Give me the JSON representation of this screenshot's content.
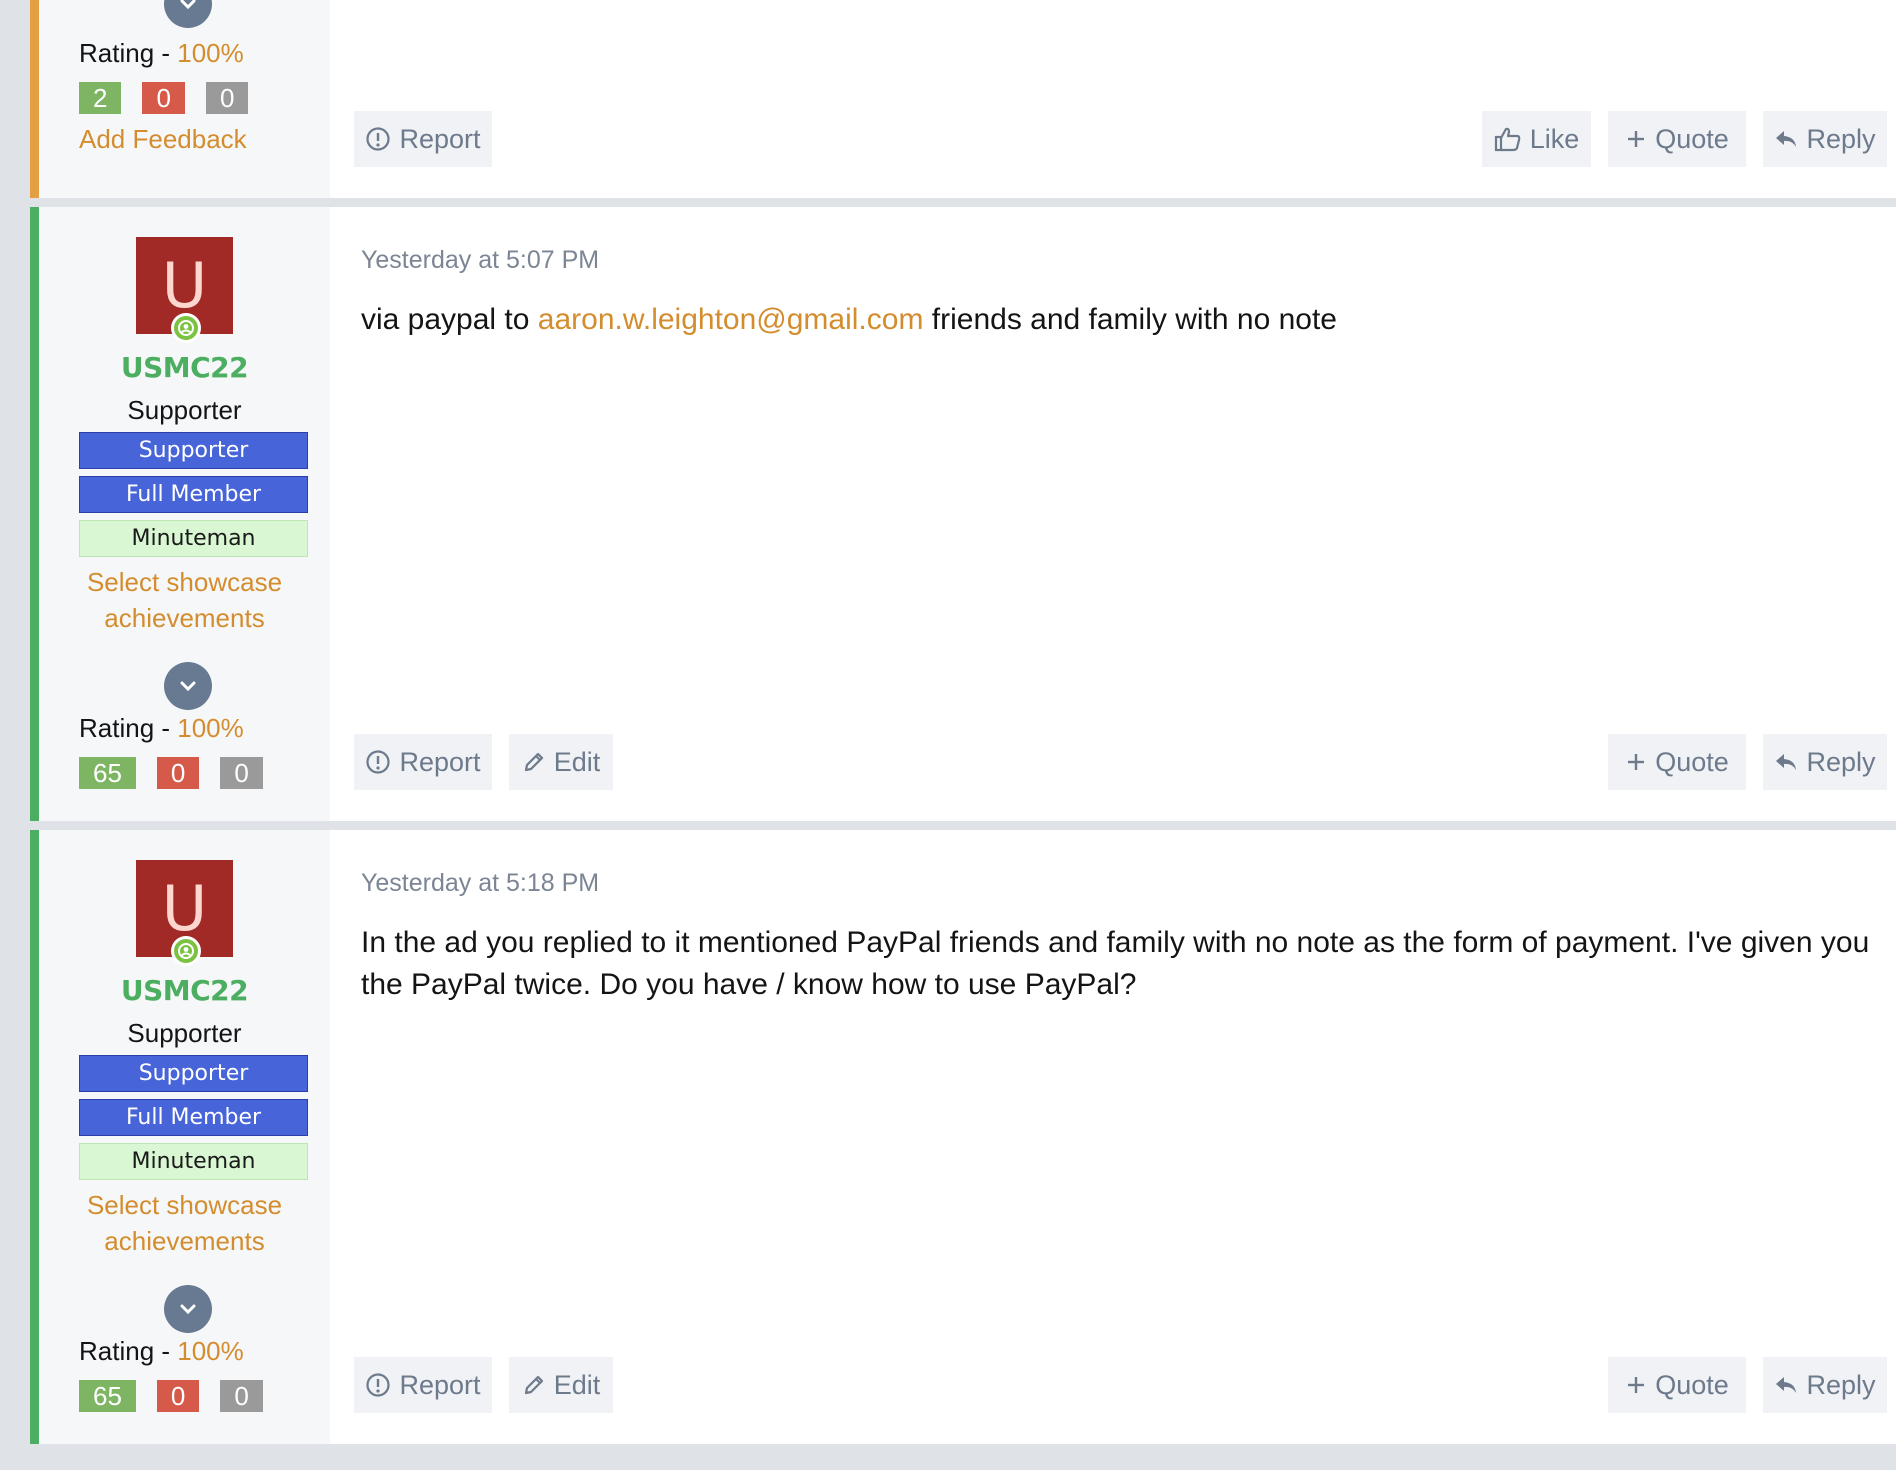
{
  "posts": [
    {
      "rating_label": "Rating - ",
      "rating_pct": "100%",
      "counts": [
        "2",
        "0",
        "0"
      ],
      "add_feedback": "Add Feedback",
      "actions": {
        "report": "Report",
        "like": "Like",
        "quote": "Quote",
        "reply": "Reply"
      }
    },
    {
      "avatar_letter": "U",
      "username": "USMC22",
      "user_title": "Supporter",
      "banners": [
        "Supporter",
        "Full Member",
        "Minuteman"
      ],
      "showcase": [
        "Select showcase",
        "achievements"
      ],
      "rating_label": "Rating - ",
      "rating_pct": "100%",
      "counts": [
        "65",
        "0",
        "0"
      ],
      "timestamp": "Yesterday at 5:07 PM",
      "body_pre": "via paypal to ",
      "body_link": "aaron.w.leighton@gmail.com",
      "body_post": " friends and family with no note",
      "actions": {
        "report": "Report",
        "edit": "Edit",
        "quote": "Quote",
        "reply": "Reply"
      }
    },
    {
      "avatar_letter": "U",
      "username": "USMC22",
      "user_title": "Supporter",
      "banners": [
        "Supporter",
        "Full Member",
        "Minuteman"
      ],
      "showcase": [
        "Select showcase",
        "achievements"
      ],
      "rating_label": "Rating - ",
      "rating_pct": "100%",
      "counts": [
        "65",
        "0",
        "0"
      ],
      "timestamp": "Yesterday at 5:18 PM",
      "body": "In the ad you replied to it mentioned PayPal friends and family with no note as the form of payment. I've given you the PayPal twice. Do you have / know how to use PayPal?",
      "actions": {
        "report": "Report",
        "edit": "Edit",
        "quote": "Quote",
        "reply": "Reply"
      }
    }
  ],
  "colors": {
    "accent": "#d48d2e",
    "online_green": "#4cae60",
    "banner_blue": "#4764d8",
    "banner_green": "#d8f7d2",
    "avatar_red": "#a22a26"
  },
  "icons": [
    "chevron-down-icon",
    "report-icon",
    "like-icon",
    "plus-icon",
    "reply-icon",
    "edit-icon",
    "online-user-icon"
  ]
}
